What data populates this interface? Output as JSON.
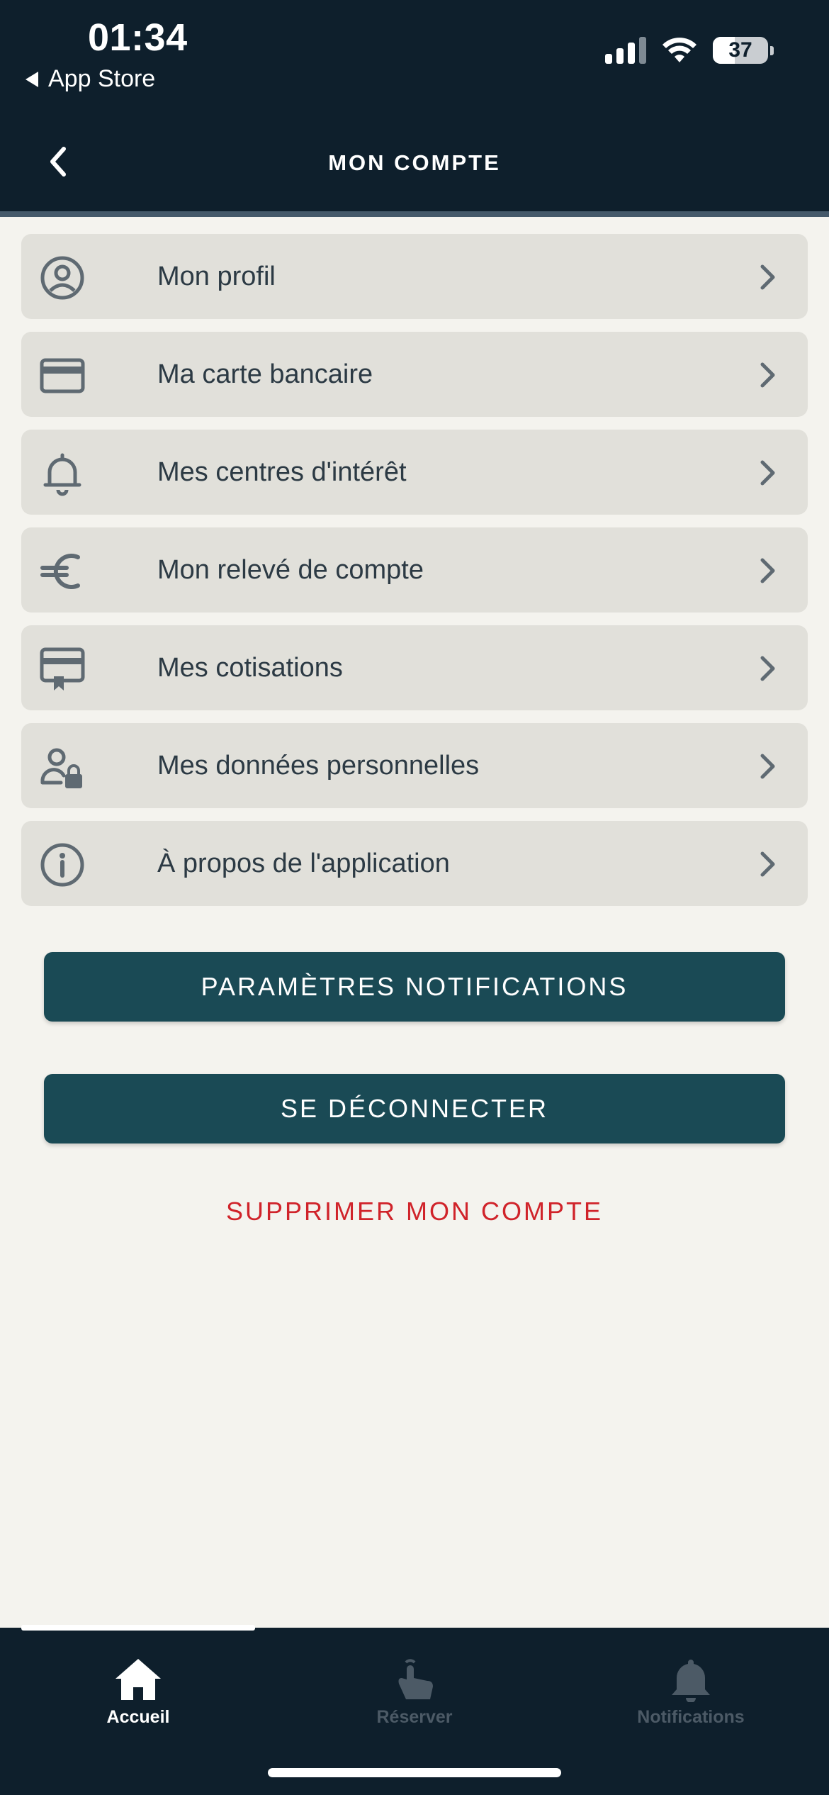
{
  "status_bar": {
    "time": "01:34",
    "back_app": "App Store",
    "battery": "37"
  },
  "header": {
    "title": "MON COMPTE"
  },
  "menu": {
    "items": [
      {
        "label": "Mon profil",
        "icon": "user-circle-icon"
      },
      {
        "label": "Ma carte bancaire",
        "icon": "credit-card-icon"
      },
      {
        "label": "Mes centres d'intérêt",
        "icon": "bell-icon"
      },
      {
        "label": "Mon relevé de compte",
        "icon": "euro-icon"
      },
      {
        "label": "Mes cotisations",
        "icon": "membership-card-icon"
      },
      {
        "label": "Mes données personnelles",
        "icon": "user-lock-icon"
      },
      {
        "label": "À propos de l'application",
        "icon": "info-icon"
      }
    ]
  },
  "buttons": {
    "notifications": "PARAMÈTRES NOTIFICATIONS",
    "logout": "SE DÉCONNECTER",
    "delete_account": "SUPPRIMER MON COMPTE"
  },
  "tabbar": {
    "home": "Accueil",
    "reserve": "Réserver",
    "notifications": "Notifications",
    "active": "home"
  },
  "colors": {
    "header_bg": "#0e1f2c",
    "page_bg": "#f4f3ee",
    "item_bg": "#e1e0da",
    "button_bg": "#1a4a55",
    "danger": "#d0232a",
    "icon": "#5f6a72"
  }
}
